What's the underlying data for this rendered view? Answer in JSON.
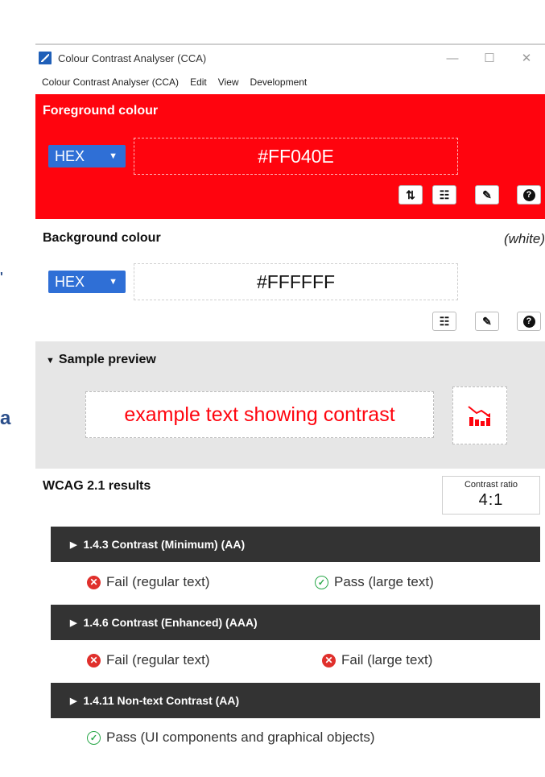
{
  "edge_glyphs": {
    "top": "'",
    "bottom": "a"
  },
  "window": {
    "title": "Colour Contrast Analyser (CCA)",
    "controls": {
      "minimize": "—",
      "maximize": "☐",
      "close": "✕"
    }
  },
  "menubar": {
    "items": [
      "Colour Contrast Analyser (CCA)",
      "Edit",
      "View",
      "Development"
    ]
  },
  "foreground": {
    "title": "Foreground colour",
    "format": "HEX",
    "value": "#FF040E",
    "tools": [
      "swap-icon",
      "sliders-icon",
      "eyedropper-icon",
      "help-icon"
    ]
  },
  "background": {
    "title": "Background colour",
    "note": "(white)",
    "format": "HEX",
    "value": "#FFFFFF",
    "tools": [
      "sliders-icon",
      "eyedropper-icon",
      "help-icon"
    ]
  },
  "preview": {
    "title": "Sample preview",
    "sample_text": "example text showing contrast",
    "icon": "contrast-chart-icon"
  },
  "results": {
    "title": "WCAG 2.1 results",
    "ratio_label": "Contrast ratio",
    "ratio_value": "4:1",
    "criteria": [
      {
        "label": "1.4.3 Contrast (Minimum) (AA)",
        "results": [
          {
            "status": "fail",
            "text": "Fail (regular text)"
          },
          {
            "status": "pass",
            "text": "Pass (large text)"
          }
        ]
      },
      {
        "label": "1.4.6 Contrast (Enhanced) (AAA)",
        "results": [
          {
            "status": "fail",
            "text": "Fail (regular text)"
          },
          {
            "status": "fail",
            "text": "Fail (large text)"
          }
        ]
      },
      {
        "label": "1.4.11 Non-text Contrast (AA)",
        "results": [
          {
            "status": "pass",
            "text": "Pass (UI components and graphical objects)"
          }
        ]
      }
    ]
  },
  "colors": {
    "foreground": "#ff040e",
    "select": "#2f6fd6",
    "criterion_bar": "#333333",
    "fail": "#e0302c",
    "pass": "#2aa84a"
  }
}
